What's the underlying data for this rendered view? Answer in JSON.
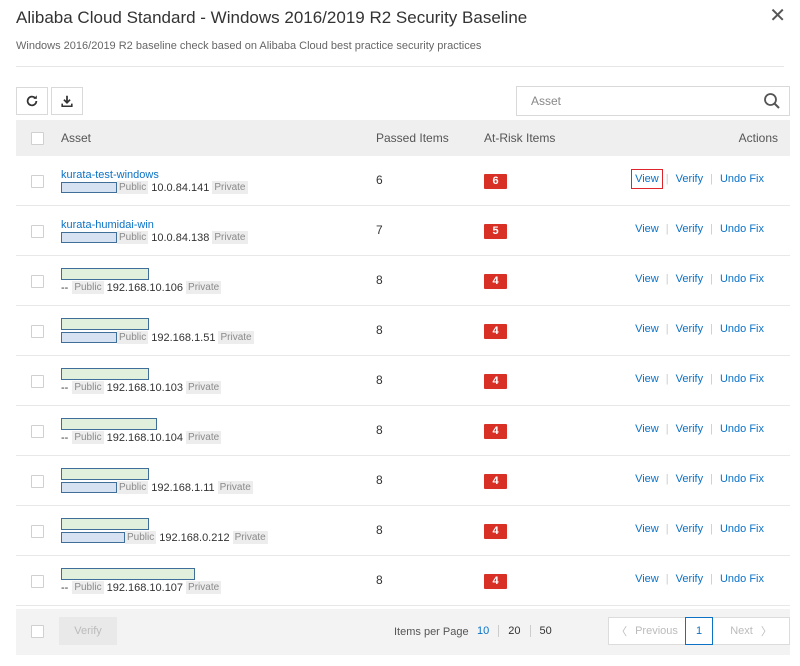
{
  "dialog": {
    "title": "Alibaba Cloud Standard - Windows 2016/2019 R2 Security Baseline",
    "subtitle": "Windows 2016/2019 R2 baseline check based on Alibaba Cloud best practice security practices",
    "close_icon": "close-icon"
  },
  "toolbar": {
    "refresh_icon": "refresh-icon",
    "download_icon": "download-icon"
  },
  "search": {
    "placeholder": "Asset",
    "icon": "search-icon"
  },
  "table": {
    "headers": {
      "asset": "Asset",
      "passed": "Passed Items",
      "at_risk": "At-Risk Items",
      "actions": "Actions"
    },
    "rows": [
      {
        "name": "kurata-test-windows",
        "public_prefix": "",
        "public_tag": "Public",
        "private_ip": "10.0.84.141",
        "private_tag": "Private",
        "passed": "6",
        "at_risk": "6"
      },
      {
        "name": "kurata-humidai-win",
        "public_prefix": "",
        "public_tag": "Public",
        "private_ip": "10.0.84.138",
        "private_tag": "Private",
        "passed": "7",
        "at_risk": "5"
      },
      {
        "name": "",
        "public_prefix": "--",
        "public_tag": "Public",
        "private_ip": "192.168.10.106",
        "private_tag": "Private",
        "passed": "8",
        "at_risk": "4"
      },
      {
        "name": "",
        "public_prefix": "",
        "public_tag": "Public",
        "private_ip": "192.168.1.51",
        "private_tag": "Private",
        "passed": "8",
        "at_risk": "4"
      },
      {
        "name": "",
        "public_prefix": "--",
        "public_tag": "Public",
        "private_ip": "192.168.10.103",
        "private_tag": "Private",
        "passed": "8",
        "at_risk": "4"
      },
      {
        "name": "",
        "public_prefix": "--",
        "public_tag": "Public",
        "private_ip": "192.168.10.104",
        "private_tag": "Private",
        "passed": "8",
        "at_risk": "4"
      },
      {
        "name": "",
        "public_prefix": "",
        "public_tag": "Public",
        "private_ip": "192.168.1.11",
        "private_tag": "Private",
        "passed": "8",
        "at_risk": "4"
      },
      {
        "name": "",
        "public_prefix": "",
        "public_tag": "Public",
        "private_ip": "192.168.0.212",
        "private_tag": "Private",
        "passed": "8",
        "at_risk": "4"
      },
      {
        "name": "",
        "public_prefix": "--",
        "public_tag": "Public",
        "private_ip": "192.168.10.107",
        "private_tag": "Private",
        "passed": "8",
        "at_risk": "4"
      }
    ],
    "actions": {
      "view": "View",
      "verify": "Verify",
      "undo_fix": "Undo Fix"
    }
  },
  "footer": {
    "verify_label": "Verify",
    "items_per_page_label": "Items per Page",
    "page_sizes": [
      "10",
      "20",
      "50"
    ],
    "selected_page_size": "10",
    "prev_label": "Previous",
    "next_label": "Next",
    "current_page": "1"
  },
  "colors": {
    "link": "#0b72c6",
    "risk_badge": "#d93026",
    "header_bg": "#efefef",
    "highlight": "#e0242b"
  }
}
